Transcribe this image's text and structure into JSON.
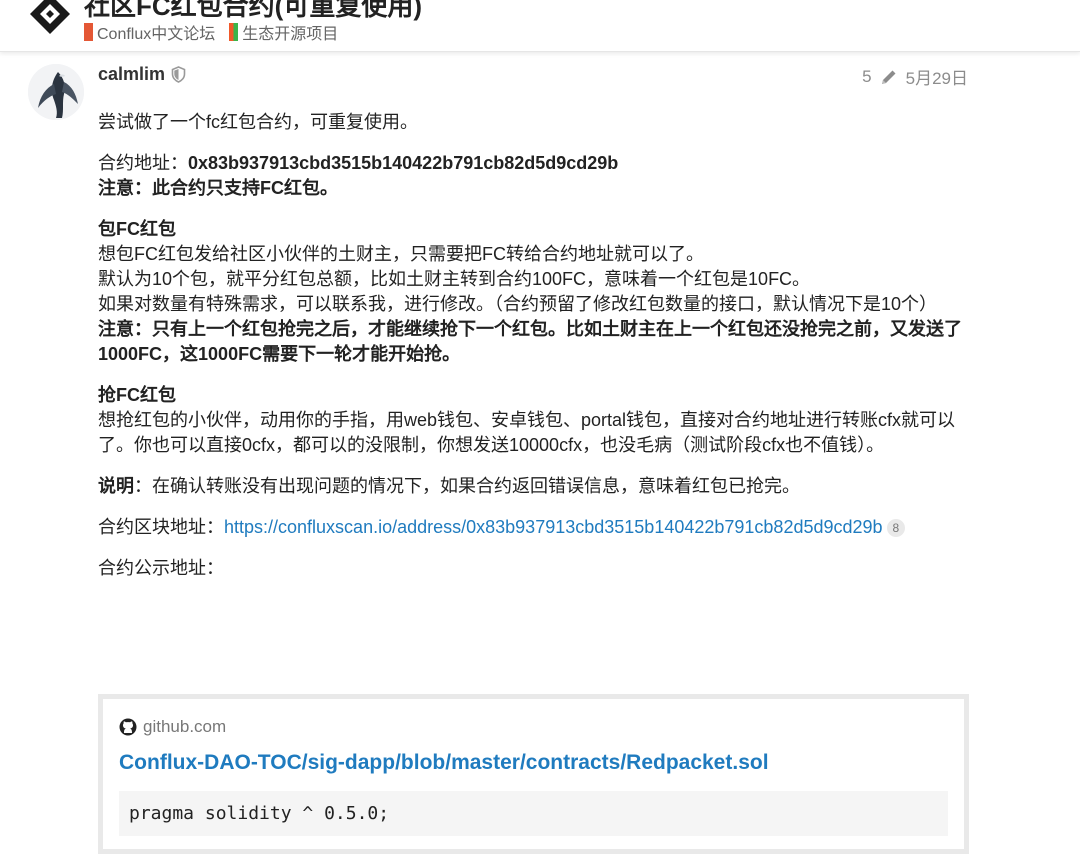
{
  "header": {
    "title": "社区FC红包合约(可重复使用)",
    "breadcrumbs": [
      {
        "label": "Conflux中文论坛",
        "color": "#e45735"
      },
      {
        "label": "生态开源项目",
        "color": "#f1592a"
      }
    ]
  },
  "post": {
    "username": "calmlim",
    "edit_count": "5",
    "date": "5月29日",
    "intro": "尝试做了一个fc红包合约，可重复使用。",
    "address_label": "合约地址：",
    "address_value": "0x83b937913cbd3515b140422b791cb82d5d9cd29b",
    "note1": "注意：此合约只支持FC红包。",
    "send_heading": "包FC红包",
    "send_lines": [
      "想包FC红包发给社区小伙伴的土财主，只需要把FC转给合约地址就可以了。",
      "默认为10个包，就平分红包总额，比如土财主转到合约100FC，意味着一个红包是10FC。",
      "如果对数量有特殊需求，可以联系我，进行修改。（合约预留了修改红包数量的接口，默认情况下是10个）"
    ],
    "send_note": "注意：只有上一个红包抢完之后，才能继续抢下一个红包。比如土财主在上一个红包还没抢完之前，又发送了1000FC，这1000FC需要下一轮才能开始抢。",
    "grab_heading": "抢FC红包",
    "grab_text": "想抢红包的小伙伴，动用你的手指，用web钱包、安卓钱包、portal钱包，直接对合约地址进行转账cfx就可以了。你也可以直接0cfx，都可以的没限制，你想发送10000cfx，也没毛病（测试阶段cfx也不值钱）。",
    "explain_label": "说明",
    "explain_text": "：在确认转账没有出现问题的情况下，如果合约返回错误信息，意味着红包已抢完。",
    "block_label": "合约区块地址：",
    "block_link": "https://confluxscan.io/address/0x83b937913cbd3515b140422b791cb82d5d9cd29b",
    "block_clicks": "8",
    "public_label": "合约公示地址："
  },
  "onebox": {
    "source": "github.com",
    "title": "Conflux-DAO-TOC/sig-dapp/blob/master/contracts/Redpacket.sol",
    "code": "pragma solidity ^ 0.5.0;"
  }
}
